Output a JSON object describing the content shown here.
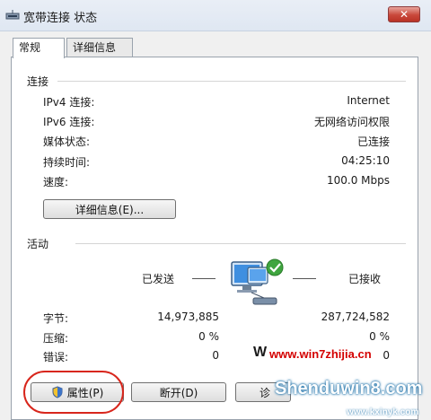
{
  "window": {
    "title": "宽带连接 状态",
    "close_label": "✕"
  },
  "tabs": [
    {
      "label": "常规",
      "active": true
    },
    {
      "label": "详细信息",
      "active": false
    }
  ],
  "connection": {
    "heading": "连接",
    "rows": [
      {
        "label": "IPv4 连接:",
        "value": "Internet"
      },
      {
        "label": "IPv6 连接:",
        "value": "无网络访问权限"
      },
      {
        "label": "媒体状态:",
        "value": "已连接"
      },
      {
        "label": "持续时间:",
        "value": "04:25:10"
      },
      {
        "label": "速度:",
        "value": "100.0 Mbps"
      }
    ],
    "details_button": "详细信息(E)..."
  },
  "activity": {
    "heading": "活动",
    "sent_label": "已发送",
    "received_label": "已接收",
    "rows": [
      {
        "label": "字节:",
        "sent": "14,973,885",
        "received": "287,724,582"
      },
      {
        "label": "压缩:",
        "sent": "0 %",
        "received": "0 %"
      },
      {
        "label": "错误:",
        "sent": "0",
        "received": "0"
      }
    ]
  },
  "buttons": {
    "properties": "属性(P)",
    "disconnect": "断开(D)",
    "diagnose": "诊"
  },
  "watermarks": {
    "win7": "www.win7zhijia.cn",
    "shendu": "Shenduwin8.com",
    "kxinyk": "www.kxinyk.com"
  },
  "colors": {
    "highlight": "#d8261c",
    "close_button": "#c9483b",
    "watermark_red": "#d40000",
    "watermark_white": "#ffffff"
  }
}
